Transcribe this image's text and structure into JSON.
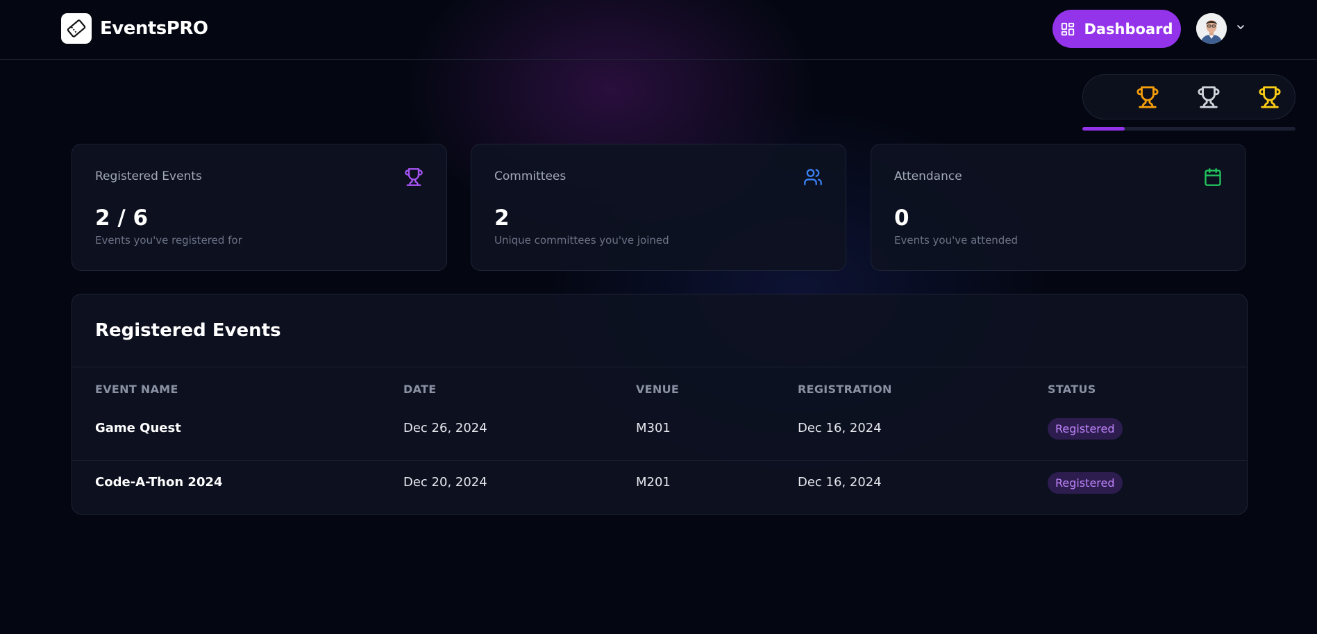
{
  "header": {
    "brand": "EventsPRO",
    "dashboard_label": "Dashboard"
  },
  "achievements": {
    "trophies": [
      "trophy-icon-orange",
      "trophy-icon-silver",
      "trophy-icon-gold"
    ],
    "progress_fraction": 0.2
  },
  "stats": [
    {
      "title": "Registered Events",
      "value": "2 / 6",
      "subtitle": "Events you've registered for",
      "icon": "trophy-icon"
    },
    {
      "title": "Committees",
      "value": "2",
      "subtitle": "Unique committees you've joined",
      "icon": "users-icon"
    },
    {
      "title": "Attendance",
      "value": "0",
      "subtitle": "Events you've attended",
      "icon": "calendar-icon"
    }
  ],
  "table": {
    "title": "Registered Events",
    "headers": [
      "EVENT NAME",
      "DATE",
      "VENUE",
      "REGISTRATION",
      "STATUS"
    ],
    "rows": [
      {
        "name": "Game Quest",
        "date": "Dec 26, 2024",
        "venue": "M301",
        "registration": "Dec 16, 2024",
        "status": "Registered"
      },
      {
        "name": "Code-A-Thon 2024",
        "date": "Dec 20, 2024",
        "venue": "M201",
        "registration": "Dec 16, 2024",
        "status": "Registered"
      }
    ]
  },
  "colors": {
    "accent": "#9333ea",
    "background": "#040712",
    "card": "#0d1221",
    "badge_bg": "#2d1d4f",
    "badge_text": "#c084fc",
    "trophy_orange": "#f59e0b",
    "trophy_silver": "#d1d5db",
    "trophy_gold": "#facc15",
    "users_icon": "#3b82f6",
    "calendar_icon": "#22c55e"
  }
}
